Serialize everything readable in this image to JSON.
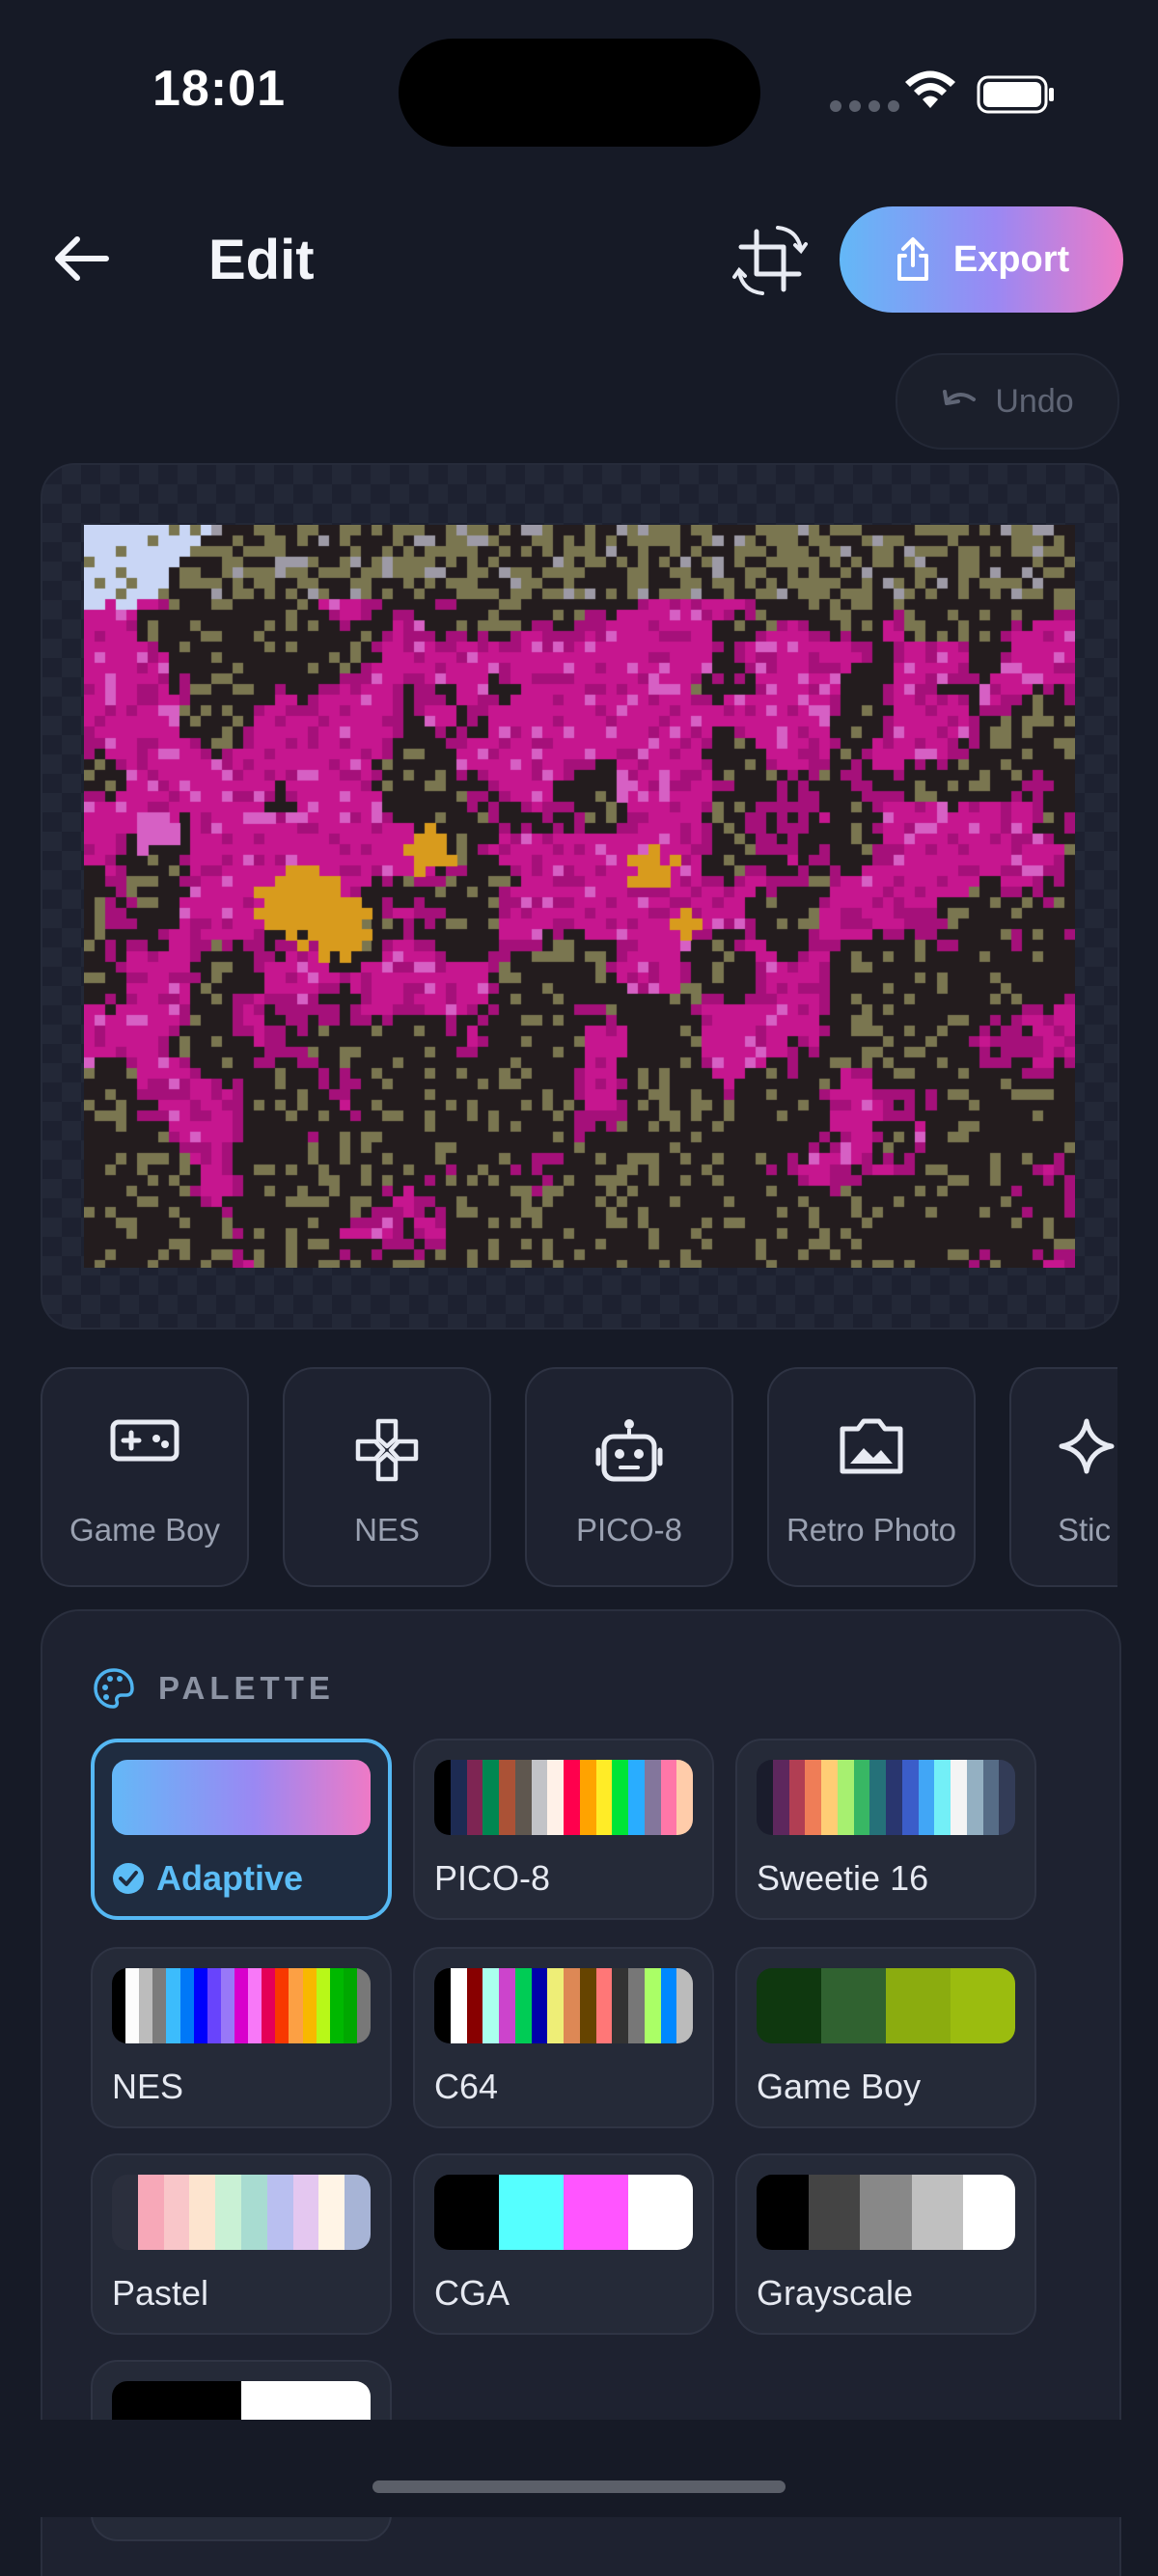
{
  "status_bar": {
    "time": "18:01"
  },
  "header": {
    "title": "Edit",
    "export_label": "Export",
    "undo_label": "Undo"
  },
  "presets": [
    {
      "label": "Game Boy",
      "icon": "gamepad-icon"
    },
    {
      "label": "NES",
      "icon": "dpad-icon"
    },
    {
      "label": "PICO-8",
      "icon": "robot-icon"
    },
    {
      "label": "Retro Photo",
      "icon": "photo-icon"
    },
    {
      "label": "Stic",
      "icon": "sparkle-icon"
    }
  ],
  "palette_section": {
    "title": "PALETTE",
    "items": [
      {
        "label": "Adaptive",
        "selected": true
      },
      {
        "label": "PICO-8"
      },
      {
        "label": "Sweetie 16"
      },
      {
        "label": "NES"
      },
      {
        "label": "C64"
      },
      {
        "label": "Game Boy"
      },
      {
        "label": "Pastel"
      },
      {
        "label": "CGA"
      },
      {
        "label": "Grayscale"
      },
      {
        "label": ""
      }
    ]
  },
  "colors": {
    "accent": "#55b8f3",
    "export_gradient": [
      "#63b8f7",
      "#9a88f3",
      "#ee7ac6"
    ],
    "background": "#161a26"
  }
}
